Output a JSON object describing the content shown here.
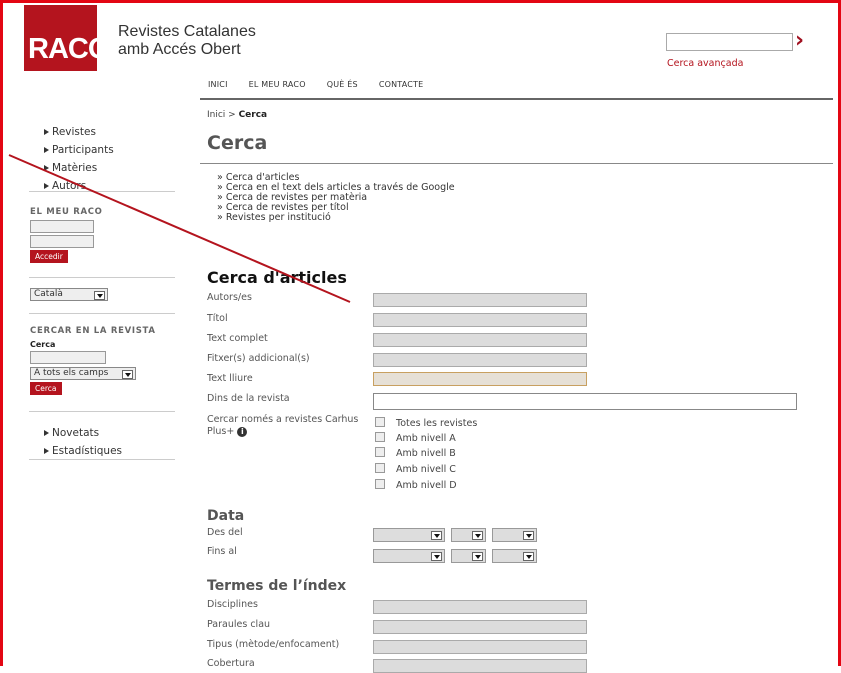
{
  "brand": {
    "logo": "RACO",
    "line1": "Revistes Catalanes",
    "line2": "amb Accés Obert"
  },
  "top_search": {
    "value": "",
    "advanced_link": "Cerca avançada"
  },
  "nav": [
    "INICI",
    "EL MEU RACO",
    "QUÈ ÉS",
    "CONTACTE"
  ],
  "breadcrumb": {
    "home": "Inici",
    "separator": " > ",
    "current": "Cerca"
  },
  "page_title": "Cerca",
  "search_links": [
    "» Cerca d'articles",
    "» Cerca en el text dels articles a través de Google",
    "» Cerca de revistes per matèria",
    "» Cerca de revistes per títol",
    "» Revistes per institució"
  ],
  "sidebar": {
    "menu": [
      "Revistes",
      "Participants",
      "Matèries",
      "Autors"
    ],
    "my_raco_title": "EL MEU RACO",
    "login_button": "Accedir",
    "language": "Català",
    "journal_search_title": "CERCAR EN LA REVISTA",
    "journal_search_label": "Cerca",
    "journal_search_field_select": "A tots els camps",
    "journal_search_button": "Cerca",
    "menu2": [
      "Novetats",
      "Estadístiques"
    ]
  },
  "article_search": {
    "title": "Cerca d'articles",
    "fields": [
      "Autors/es",
      "Títol",
      "Text complet",
      "Fitxer(s) addicional(s)",
      "Text lliure",
      "Dins de la revista"
    ],
    "carhus_label": "Cercar només a revistes Carhus Plus+",
    "carhus_options": [
      "Totes les revistes",
      "Amb nivell A",
      "Amb nivell B",
      "Amb nivell C",
      "Amb nivell D"
    ]
  },
  "date_section": {
    "title": "Data",
    "from_label": "Des del",
    "to_label": "Fins al"
  },
  "index_terms": {
    "title": "Termes de l’índex",
    "fields": [
      "Disciplines",
      "Paraules clau",
      "Tipus (mètode/enfocament)",
      "Cobertura"
    ]
  },
  "colors": {
    "brand_red": "#b4141e",
    "frame_red": "#e30613"
  }
}
